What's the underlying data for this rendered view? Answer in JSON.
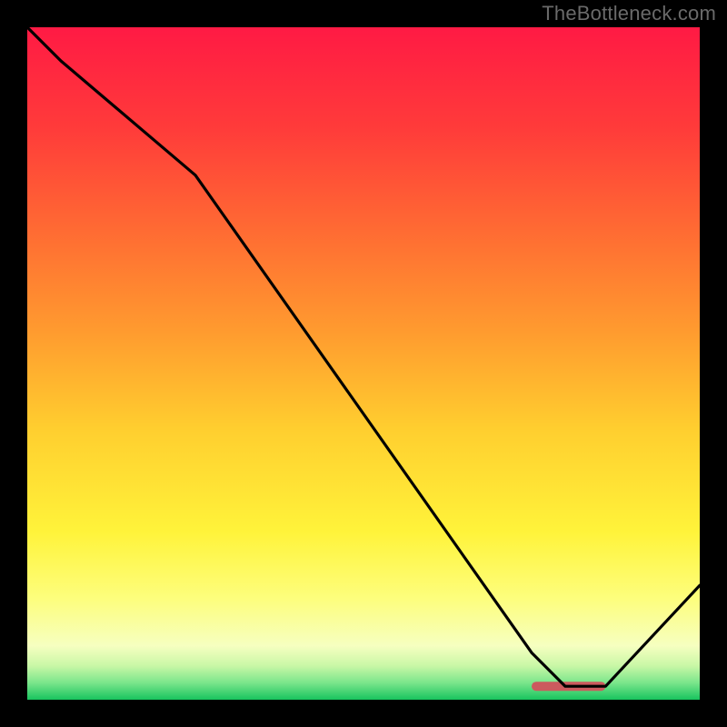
{
  "watermark": "TheBottleneck.com",
  "chart_data": {
    "type": "line",
    "title": "",
    "xlabel": "",
    "ylabel": "",
    "xlim": [
      0,
      100
    ],
    "ylim": [
      0,
      100
    ],
    "x": [
      0,
      5,
      25,
      75,
      80,
      86,
      100
    ],
    "values": [
      100,
      95,
      78,
      7,
      2,
      2,
      17
    ],
    "marker": {
      "x_range": [
        75,
        86
      ],
      "y": 2,
      "color": "#cc5a5e"
    },
    "gradient_stops": [
      {
        "pos": 0.0,
        "color": "#ff1a44"
      },
      {
        "pos": 0.15,
        "color": "#ff3b3a"
      },
      {
        "pos": 0.3,
        "color": "#ff6a33"
      },
      {
        "pos": 0.45,
        "color": "#ff9a2f"
      },
      {
        "pos": 0.6,
        "color": "#ffcf2f"
      },
      {
        "pos": 0.75,
        "color": "#fff33a"
      },
      {
        "pos": 0.85,
        "color": "#fdfe7d"
      },
      {
        "pos": 0.92,
        "color": "#f6ffc0"
      },
      {
        "pos": 0.95,
        "color": "#c8f7a6"
      },
      {
        "pos": 0.975,
        "color": "#7ae58b"
      },
      {
        "pos": 1.0,
        "color": "#18c45e"
      }
    ]
  }
}
